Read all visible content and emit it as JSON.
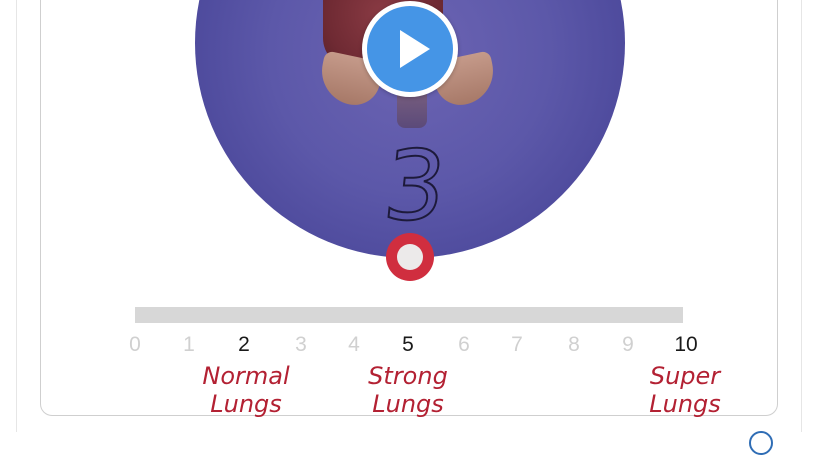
{
  "video": {
    "count": "3",
    "play_label": "Play"
  },
  "scale": {
    "ticks": [
      "0",
      "1",
      "2",
      "3",
      "4",
      "5",
      "6",
      "7",
      "8",
      "9",
      "10"
    ],
    "highlighted": [
      2,
      5,
      10
    ],
    "captions": {
      "normal": "Normal\nLungs",
      "strong": "Strong\nLungs",
      "super": "Super\nLungs"
    }
  },
  "colors": {
    "accent_red": "#b32133",
    "play_blue": "#4595e6",
    "circle_purple": "#5c58a9"
  }
}
